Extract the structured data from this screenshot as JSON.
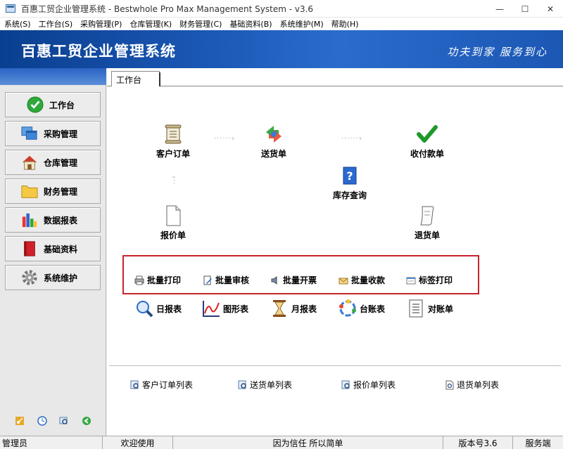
{
  "window": {
    "title": "百惠工贸企业管理系统 - Bestwhole Pro Max Management System - v3.6",
    "controls": [
      "—",
      "☐",
      "✕"
    ]
  },
  "menubar": [
    "系统(S)",
    "工作台(S)",
    "采购管理(P)",
    "仓库管理(K)",
    "财务管理(C)",
    "基础资料(B)",
    "系统维护(M)",
    "帮助(H)"
  ],
  "banner": {
    "system_name": "百惠工贸企业管理系统",
    "slogan": "功夫到家 服务到心"
  },
  "sidebar": {
    "items": [
      {
        "label": "工作台",
        "icon": "check-icon"
      },
      {
        "label": "采购管理",
        "icon": "windows-icon"
      },
      {
        "label": "仓库管理",
        "icon": "house-icon"
      },
      {
        "label": "财务管理",
        "icon": "folder-icon"
      },
      {
        "label": "数据报表",
        "icon": "bar-chart-icon"
      },
      {
        "label": "基础资料",
        "icon": "book-icon"
      },
      {
        "label": "系统维护",
        "icon": "gear-icon"
      }
    ],
    "bottom_icons": [
      "key-icon",
      "clock-icon",
      "search-icon",
      "back-icon"
    ]
  },
  "tab": {
    "label": "工作台"
  },
  "flow": {
    "customer_order": "客户订单",
    "delivery": "送货单",
    "payment": "收付款单",
    "stock_query": "库存查询",
    "quote": "报价单",
    "return": "退货单"
  },
  "batch": {
    "print": "批量打印",
    "audit": "批量审核",
    "invoice": "批量开票",
    "receive": "批量收款",
    "label_print": "标签打印"
  },
  "reports": {
    "daily": "日报表",
    "graph": "图形表",
    "monthly": "月报表",
    "ledger": "台账表",
    "statement": "对账单"
  },
  "lists": {
    "customer_order_list": "客户订单列表",
    "delivery_list": "送货单列表",
    "quote_list": "报价单列表",
    "return_list": "退货单列表"
  },
  "status": {
    "user": "管理员",
    "welcome": "欢迎使用",
    "motto": "因为信任 所以简单",
    "version": "版本号3.6",
    "server": "服务端"
  },
  "colors": {
    "banner": "#1a56b3",
    "highlight_box": "#c8232b"
  }
}
